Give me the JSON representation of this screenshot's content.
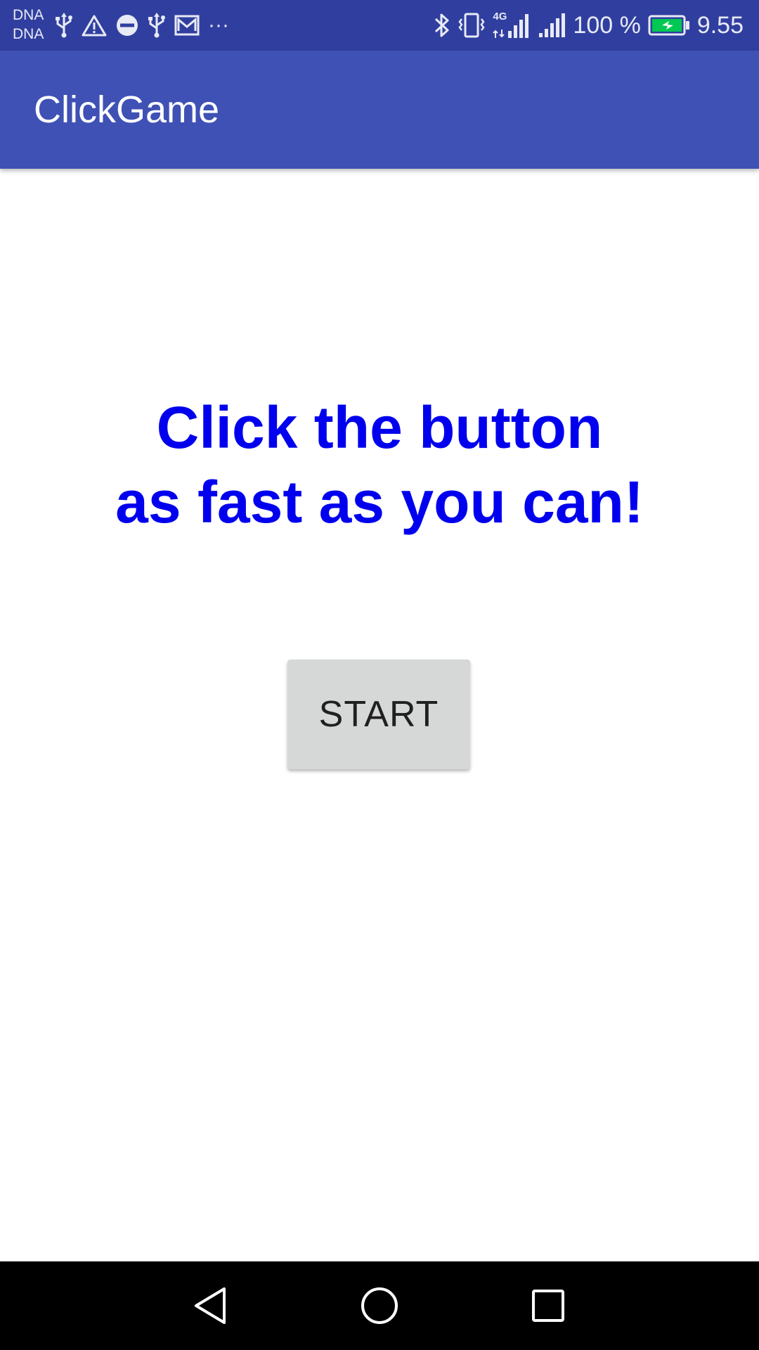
{
  "status_bar": {
    "carrier_line1": "DNA",
    "carrier_line2": "DNA",
    "overflow": "···",
    "network_badge": "4G",
    "battery_percent": "100 %",
    "time": "9.55",
    "left_icons": [
      "usb-icon",
      "warning-icon",
      "do-not-disturb-icon",
      "usb-icon",
      "mail-icon"
    ],
    "right_icons": [
      "bluetooth-icon",
      "vibrate-icon",
      "signal-4g-icon",
      "signal-icon",
      "battery-charging-icon"
    ],
    "colors": {
      "background": "#303f9f",
      "battery": "#00c853"
    }
  },
  "app_bar": {
    "title": "ClickGame",
    "color": "#3f51b5"
  },
  "main": {
    "headline_line1": "Click the button",
    "headline_line2": "as fast as you can!",
    "headline_color": "#0000ee",
    "start_label": "START"
  },
  "nav_bar": {
    "buttons": [
      "back-icon",
      "home-icon",
      "recents-icon"
    ]
  }
}
